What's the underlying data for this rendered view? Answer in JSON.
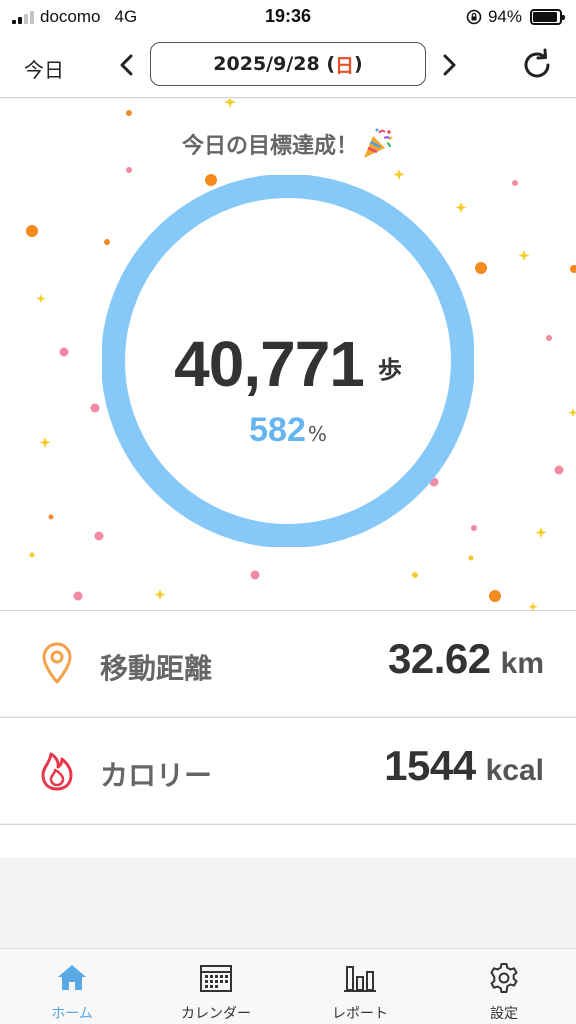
{
  "status_bar": {
    "carrier": "docomo",
    "network": "4G",
    "time": "19:36",
    "battery_text": "94%",
    "battery_level": 0.94
  },
  "header": {
    "today_label": "今日",
    "date_text": "2025/9/28 (",
    "weekday": "日",
    "date_close": ")",
    "prev_icon": "chevron-left-icon",
    "next_icon": "chevron-right-icon",
    "refresh_icon": "refresh-icon"
  },
  "hero": {
    "goal_message": "今日の目標達成！",
    "party_icon": "party-popper-icon",
    "steps": "40,771",
    "steps_unit": "歩",
    "percent": "582",
    "percent_sign": "%",
    "ring_color": "#86c8f7",
    "ring_progress": 1.0
  },
  "stats": [
    {
      "icon": "map-pin-icon",
      "label": "移動距離",
      "value": "32.62",
      "unit": "km",
      "icon_color": "#f5a04a"
    },
    {
      "icon": "flame-icon",
      "label": "カロリー",
      "value": "1544",
      "unit": "kcal",
      "icon_color": "#e8374a"
    }
  ],
  "tabbar": {
    "items": [
      {
        "label": "ホーム",
        "icon": "home-icon",
        "active": true
      },
      {
        "label": "カレンダー",
        "icon": "calendar-icon",
        "active": false
      },
      {
        "label": "レポート",
        "icon": "bar-chart-icon",
        "active": false
      },
      {
        "label": "設定",
        "icon": "gear-icon",
        "active": false
      }
    ],
    "active_color": "#5aa9e6"
  }
}
